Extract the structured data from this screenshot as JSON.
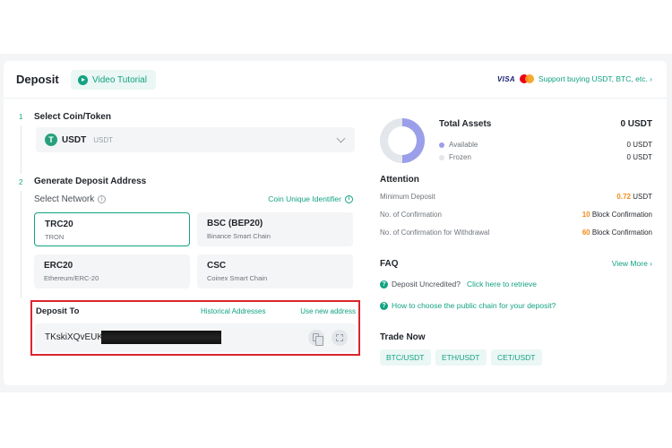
{
  "header": {
    "title": "Deposit",
    "video_tutorial": "Video Tutorial",
    "visa": "VISA",
    "support_link": "Support buying USDT, BTC, etc. ›"
  },
  "steps": {
    "step1_num": "1",
    "step1_label": "Select Coin/Token",
    "coin": {
      "symbol": "USDT",
      "name": "USDT",
      "icon": "T"
    },
    "step2_num": "2",
    "step2_label": "Generate Deposit Address",
    "network_label": "Select Network",
    "coin_uid_link": "Coin Unique Identifier",
    "networks": [
      {
        "title": "TRC20",
        "sub": "TRON",
        "selected": true
      },
      {
        "title": "BSC (BEP20)",
        "sub": "Binance Smart Chain",
        "selected": false
      },
      {
        "title": "ERC20",
        "sub": "Ethereum/ERC-20",
        "selected": false
      },
      {
        "title": "CSC",
        "sub": "Coinex Smart Chain",
        "selected": false
      }
    ]
  },
  "deposit": {
    "label": "Deposit To",
    "historical": "Historical Addresses",
    "new_address": "Use new address",
    "address_visible": "TKskiXQvEUK"
  },
  "assets": {
    "title": "Total Assets",
    "total": "0 USDT",
    "available_label": "Available",
    "available_value": "0 USDT",
    "frozen_label": "Frozen",
    "frozen_value": "0 USDT",
    "available_color": "#9b9ee8",
    "frozen_color": "#e3e6ea"
  },
  "attention": {
    "title": "Attention",
    "rows": [
      {
        "label": "Minimum Deposit",
        "value": "0.72",
        "unit": " USDT"
      },
      {
        "label": "No. of Confirmation",
        "value": "10",
        "unit": " Block Confirmation"
      },
      {
        "label": "No. of Confirmation for Withdrawal",
        "value": "60",
        "unit": " Block Confirmation"
      }
    ]
  },
  "faq": {
    "title": "FAQ",
    "view_more": "View More ›",
    "q1_text": "Deposit Uncredited?",
    "q1_link": "Click here to retrieve",
    "q2_link": "How to choose the public chain for your deposit?"
  },
  "trade": {
    "title": "Trade Now",
    "pairs": [
      "BTC/USDT",
      "ETH/USDT",
      "CET/USDT"
    ]
  },
  "colors": {
    "accent": "#13a283",
    "highlight": "#f08c1a",
    "redact_box": "#d9262c"
  }
}
